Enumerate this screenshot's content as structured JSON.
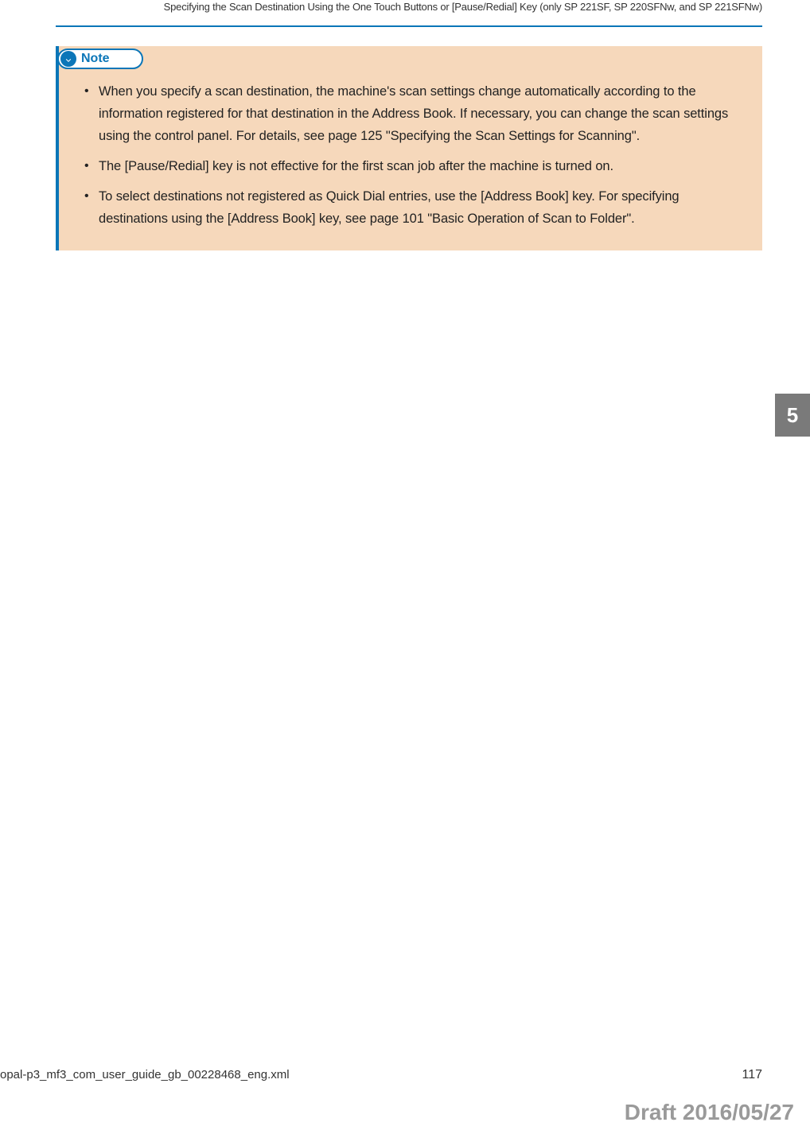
{
  "header": {
    "title": "Specifying the Scan Destination Using the One Touch Buttons or [Pause/Redial] Key (only SP 221SF, SP 220SFNw, and SP 221SFNw)"
  },
  "note": {
    "label": "Note",
    "items": [
      "When you specify a scan destination, the machine's scan settings change automatically according to the information registered for that destination in the Address Book. If necessary, you can change the scan settings using the control panel. For details, see page 125 \"Specifying the Scan Settings for Scanning\".",
      "The [Pause/Redial] key is not effective for the first scan job after the machine is turned on.",
      "To select destinations not registered as Quick Dial entries, use the [Address Book] key. For specifying destinations using the [Address Book] key, see page 101 \"Basic Operation of Scan to Folder\"."
    ]
  },
  "chapter": {
    "number": "5"
  },
  "footer": {
    "left": "opal-p3_mf3_com_user_guide_gb_00228468_eng.xml",
    "right": "117"
  },
  "draft": "Draft 2016/05/27"
}
